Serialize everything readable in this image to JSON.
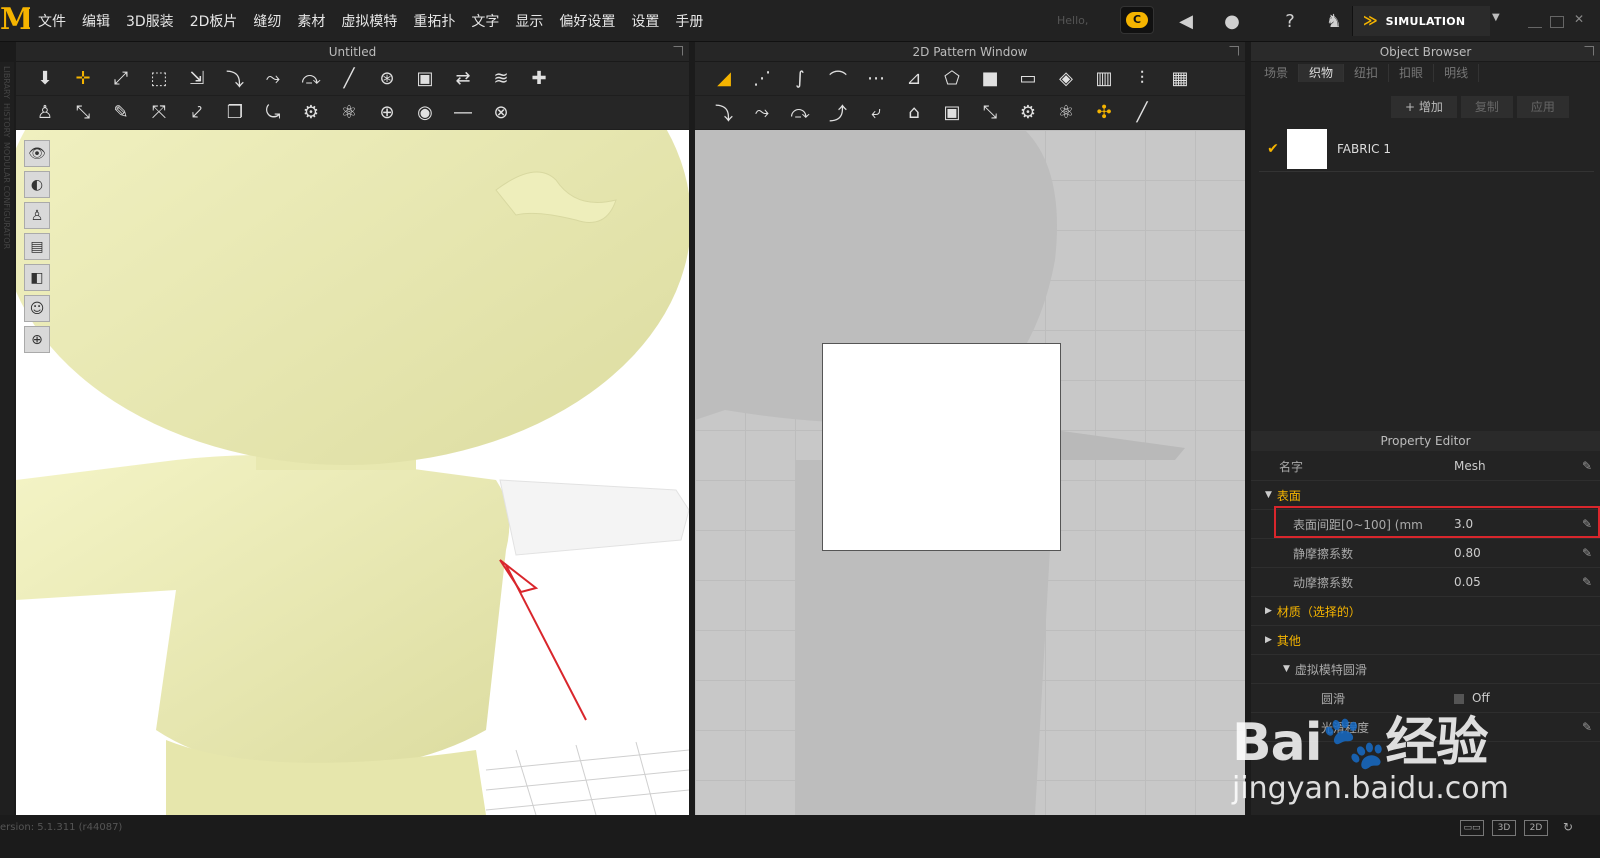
{
  "menubar": {
    "logo": "M",
    "items": [
      "文件",
      "编辑",
      "3D服装",
      "2D板片",
      "缝纫",
      "素材",
      "虚拟模特",
      "重拓扑",
      "文字",
      "显示",
      "偏好设置",
      "设置",
      "手册"
    ],
    "hello": "Hello,",
    "cloud": "C",
    "simulation_label": "SIMULATION"
  },
  "panels": {
    "view3d_title": "Untitled",
    "view2d_title": "2D Pattern Window",
    "object_browser_title": "Object Browser",
    "property_editor_title": "Property Editor"
  },
  "left_gutter": [
    "LIBRARY",
    "HISTORY",
    "MODULAR CONFIGURATOR"
  ],
  "object_browser": {
    "tabs": [
      "场景",
      "织物",
      "纽扣",
      "扣眼",
      "明线"
    ],
    "active_tab": "织物",
    "add_label": "+ 增加",
    "copy_label": "复制",
    "apply_label": "应用",
    "fabric_name": "FABRIC 1",
    "fabric_color": "#ffffff"
  },
  "property_editor": {
    "name_label": "名字",
    "name_value": "Mesh",
    "surface_section": "表面",
    "rows": [
      {
        "label": "表面间距[0~100] (mm",
        "value": "3.0"
      },
      {
        "label": "静摩擦系数",
        "value": "0.80"
      },
      {
        "label": "动摩擦系数",
        "value": "0.05"
      }
    ],
    "material_section": "材质（选择的）",
    "other_section": "其他",
    "avatar_smooth_section": "虚拟模特圆滑",
    "smooth_label": "圆滑",
    "smooth_value": "Off",
    "extra_label": "光滑程度"
  },
  "status": {
    "version": "ersion: 5.1.311 (r44087)",
    "view_icons": [
      "▭▭",
      "3D",
      "2D"
    ]
  },
  "watermark": {
    "brand": "Bai",
    "suffix": "经验",
    "url": "jingyan.baidu.com"
  },
  "colors": {
    "accent": "#f5b400",
    "highlight_red": "#d9262c",
    "avatar_yellow": "#efefb8"
  }
}
